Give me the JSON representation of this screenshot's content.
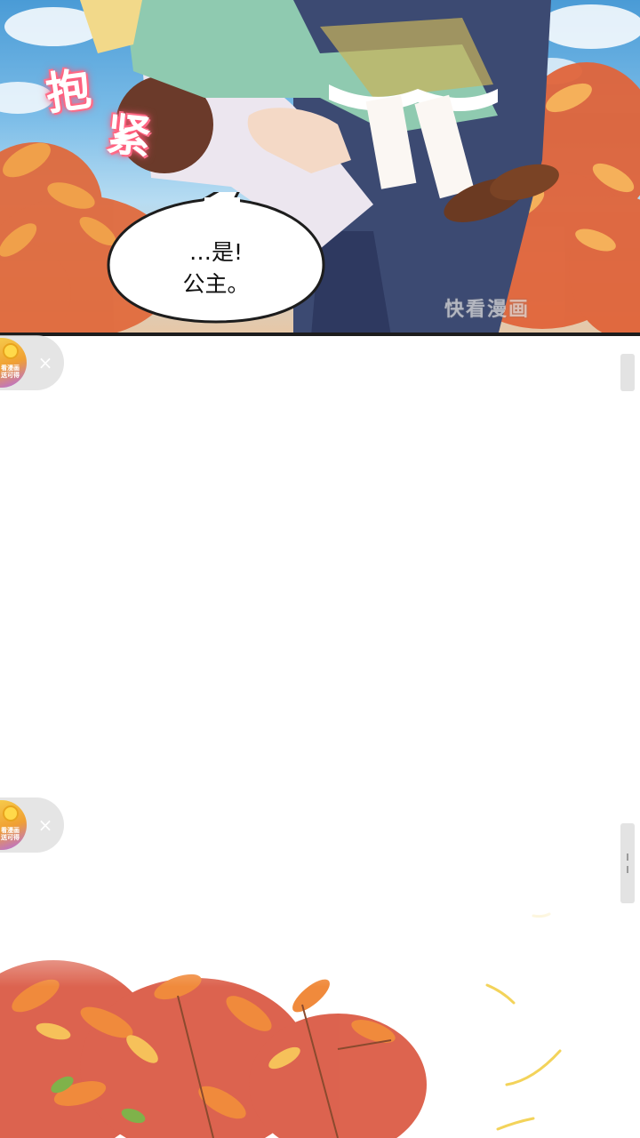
{
  "comic": {
    "panel_top": {
      "sfx": "抱紧",
      "sfx_chars": [
        "抱",
        "紧"
      ],
      "bubble": {
        "line1": "…是!",
        "line2": "公主。"
      },
      "watermark": "快看漫画"
    }
  },
  "ad_widgets": [
    {
      "icon": "coin-reward-icon",
      "label": "看漫画\n送可得",
      "close": "×"
    },
    {
      "icon": "coin-reward-icon",
      "label": "看漫画\n送可得",
      "close": "×"
    }
  ],
  "colors": {
    "sky": "#7cbde8",
    "foliage_red": "#d9533c",
    "foliage_orange": "#f08a3c",
    "bubble_border": "#1d1d1d",
    "ad_bg": "#dcdcdc"
  }
}
